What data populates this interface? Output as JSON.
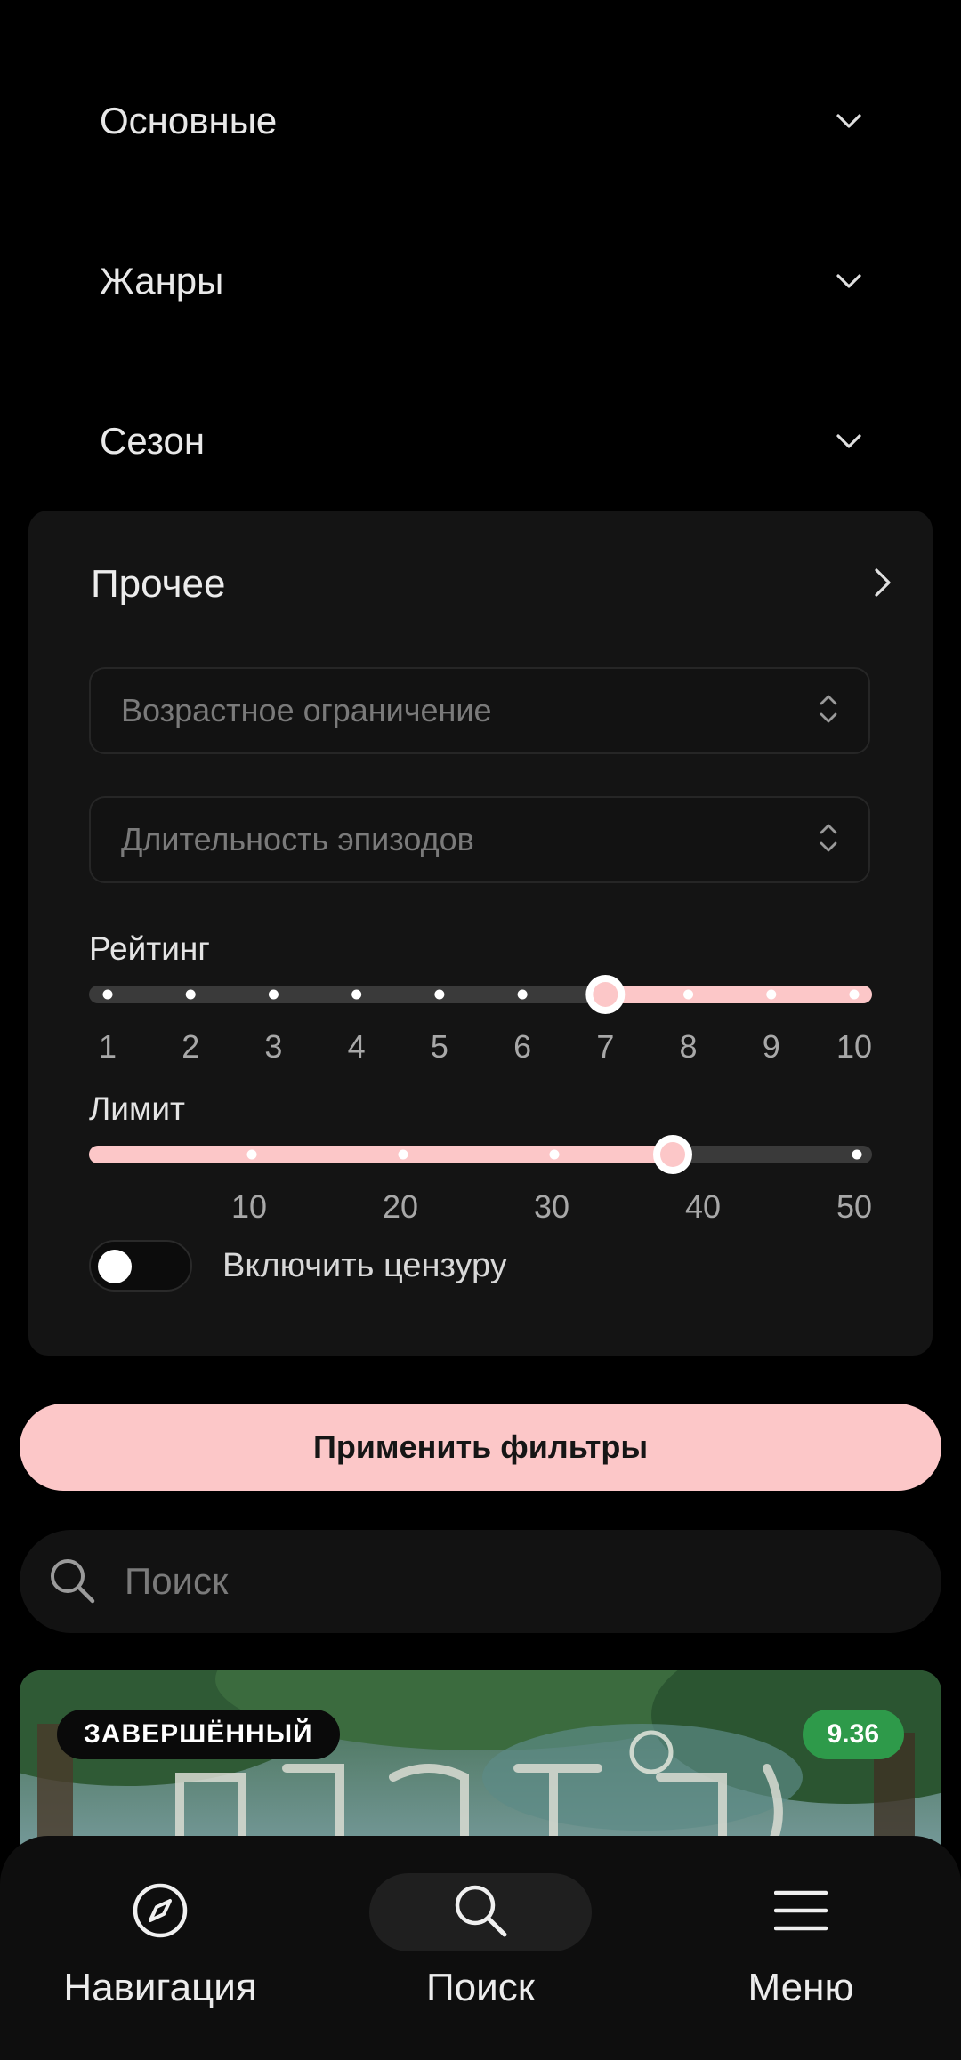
{
  "sections": [
    {
      "label": "Основные",
      "icon": "chevron-down-icon"
    },
    {
      "label": "Жанры",
      "icon": "chevron-down-icon"
    },
    {
      "label": "Сезон",
      "icon": "chevron-down-icon"
    }
  ],
  "other_panel": {
    "title": "Прочее",
    "icon": "chevron-right-icon",
    "age_select": {
      "placeholder": "Возрастное ограничение",
      "icon": "unfold-icon"
    },
    "duration_select": {
      "placeholder": "Длительность эпизодов",
      "icon": "unfold-icon"
    },
    "rating": {
      "label": "Рейтинг",
      "ticks": [
        "1",
        "2",
        "3",
        "4",
        "5",
        "6",
        "7",
        "8",
        "9",
        "10"
      ],
      "min": 1,
      "max": 10,
      "value": 7,
      "active_side": "right"
    },
    "limit": {
      "label": "Лимит",
      "ticks": [
        "10",
        "20",
        "30",
        "40",
        "50"
      ],
      "min": 0,
      "max": 50,
      "value": 38,
      "active_side": "left"
    },
    "censor": {
      "label": "Включить цензуру",
      "enabled": false
    }
  },
  "apply_button": {
    "label": "Применить фильтры"
  },
  "search": {
    "placeholder": "Поиск",
    "icon": "search-icon"
  },
  "card": {
    "status": "ЗАВЕРШЁННЫЙ",
    "score": "9.36"
  },
  "navbar": {
    "items": [
      {
        "label": "Навигация",
        "icon": "compass-icon",
        "active": false
      },
      {
        "label": "Поиск",
        "icon": "search-icon",
        "active": true
      },
      {
        "label": "Меню",
        "icon": "menu-icon",
        "active": false
      }
    ]
  },
  "colors": {
    "background": "#000000",
    "panel": "#141414",
    "accent": "#fcc7c8",
    "track": "#3a3a3a",
    "score_badge": "#2e9a4a"
  }
}
